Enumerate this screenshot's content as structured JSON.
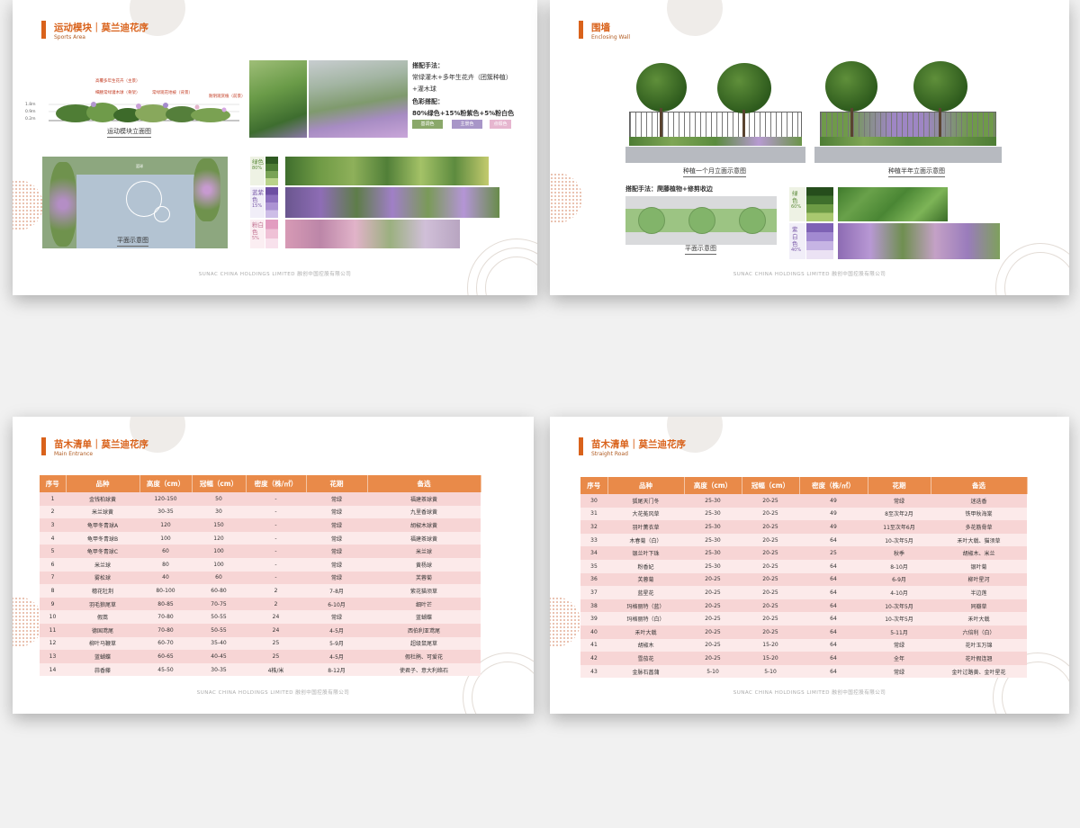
{
  "sports": {
    "title": "运动模块｜莫兰迪花序",
    "subtitle": "Sports Area",
    "elevation_caption": "运动模块立面图",
    "plan_caption": "平面示意图",
    "scale_marks": [
      "1.8m",
      "0.9m",
      "0.2m"
    ],
    "annotations": [
      "高覆多年生花卉（主景）",
      "细腰常绿灌木球（骨架）",
      "常绿观花地被（背景）",
      "耐阴观赏植（前景）"
    ],
    "method_label": "搭配手法：",
    "method_text_1": "常绿灌木+多年生花卉（团簇种植）",
    "method_text_2": "+灌木球",
    "color_label": "色彩搭配：",
    "color_ratio": "80%绿色+15%粉紫色+5%粉白色",
    "tags": [
      "基调色",
      "主景色",
      "点缀色"
    ],
    "palette": [
      {
        "label": "绿色",
        "pct": "80%"
      },
      {
        "label": "蓝紫色",
        "pct": "15%"
      },
      {
        "label": "粉白色",
        "pct": "5%"
      }
    ],
    "plan_mark": "篮球"
  },
  "wall": {
    "title": "围墙",
    "subtitle": "Enclosing Wall",
    "caption_1": "种植一个月立面示意图",
    "caption_2": "种植半年立面示意图",
    "method": "搭配手法：爬藤植物+修剪收边",
    "plan_caption": "平面示意图",
    "palette": [
      {
        "label": "绿色",
        "pct": "60%"
      },
      {
        "label": "紫白色",
        "pct": "40%"
      }
    ]
  },
  "footer": "SUNAC CHINA HOLDINGS LIMITED  融创中国控股有限公司",
  "table1": {
    "title": "苗木清单｜莫兰迪花序",
    "subtitle": "Main Entrance",
    "headers": [
      "序号",
      "品种",
      "高度（cm）",
      "冠幅（cm）",
      "密度（株/㎡）",
      "花期",
      "备选"
    ],
    "rows": [
      [
        "1",
        "金钱柏球黄",
        "120-150",
        "50",
        "-",
        "常绿",
        "福建茶球黄"
      ],
      [
        "2",
        "米兰球黄",
        "30-35",
        "30",
        "-",
        "常绿",
        "九里香球黄"
      ],
      [
        "3",
        "龟甲冬青球A",
        "120",
        "150",
        "-",
        "常绿",
        "胡椒木球黄"
      ],
      [
        "4",
        "龟甲冬青球B",
        "100",
        "120",
        "-",
        "常绿",
        "福建茶球黄"
      ],
      [
        "5",
        "龟甲冬青球C",
        "60",
        "100",
        "-",
        "常绿",
        "米兰球"
      ],
      [
        "6",
        "米兰球",
        "80",
        "100",
        "-",
        "常绿",
        "黄杨球"
      ],
      [
        "7",
        "雾松球",
        "40",
        "60",
        "-",
        "常绿",
        "芙蓉菊"
      ],
      [
        "8",
        "穗花牡荆",
        "80-100",
        "60-80",
        "2",
        "7-8月",
        "紫花猫须草"
      ],
      [
        "9",
        "羽毛狼尾草",
        "80-85",
        "70-75",
        "2",
        "6-10月",
        "细叶芒"
      ],
      [
        "10",
        "假蒿",
        "70-80",
        "50-55",
        "24",
        "常绿",
        "蓝蝴蝶"
      ],
      [
        "11",
        "德国鸢尾",
        "70-80",
        "50-55",
        "24",
        "4-5月",
        "西伯利亚鸢尾"
      ],
      [
        "12",
        "柳叶马鞭草",
        "60-70",
        "35-40",
        "25",
        "5-9月",
        "超级鼠尾草"
      ],
      [
        "13",
        "蓝蝴蝶",
        "60-65",
        "40-45",
        "25",
        "4-5月",
        "假杜鹃、可爱花"
      ],
      [
        "14",
        "蒜香藤",
        "45-50",
        "30-35",
        "4株/米",
        "8-12月",
        "使君子、意大利络石"
      ]
    ]
  },
  "table2": {
    "title": "苗木清单｜莫兰迪花序",
    "subtitle": "Straight Road",
    "headers": [
      "序号",
      "品种",
      "高度（cm）",
      "冠幅（cm）",
      "密度（株/㎡）",
      "花期",
      "备选"
    ],
    "rows": [
      [
        "30",
        "狐尾天门冬",
        "25-30",
        "20-25",
        "49",
        "常绿",
        "迷迭香"
      ],
      [
        "31",
        "大花菟风草",
        "25-30",
        "20-25",
        "49",
        "8至次年2月",
        "铁甲秋海棠"
      ],
      [
        "32",
        "羽叶薰衣草",
        "25-30",
        "20-25",
        "49",
        "11至次年6月",
        "多花筋骨草"
      ],
      [
        "33",
        "木春菊（白）",
        "25-30",
        "20-25",
        "64",
        "10-次年5月",
        "禾叶大戟、猫须草"
      ],
      [
        "34",
        "银兰叶下珠",
        "25-30",
        "20-25",
        "25",
        "秋季",
        "胡椒木、米兰"
      ],
      [
        "35",
        "粉香妃",
        "25-30",
        "20-25",
        "64",
        "8-10月",
        "银叶菊"
      ],
      [
        "36",
        "芙蓉菊",
        "20-25",
        "20-25",
        "64",
        "6-9月",
        "柳叶星河"
      ],
      [
        "37",
        "蓝星花",
        "20-25",
        "20-25",
        "64",
        "4-10月",
        "半边莲"
      ],
      [
        "38",
        "玛格丽特（蓝）",
        "20-25",
        "20-25",
        "64",
        "10-次年5月",
        "同瓣草"
      ],
      [
        "39",
        "玛格丽特（白）",
        "20-25",
        "20-25",
        "64",
        "10-次年5月",
        "禾叶大戟"
      ],
      [
        "40",
        "禾叶大戟",
        "20-25",
        "20-25",
        "64",
        "5-11月",
        "六倍利（白）"
      ],
      [
        "41",
        "胡椒木",
        "20-25",
        "15-20",
        "64",
        "常绿",
        "花叶玉万锦"
      ],
      [
        "42",
        "雪茄花",
        "20-25",
        "15-20",
        "64",
        "全年",
        "花叶假连翘"
      ],
      [
        "43",
        "金脉石菖蒲",
        "5-10",
        "5-10",
        "64",
        "常绿",
        "金叶过路黄、金叶星花"
      ]
    ]
  }
}
